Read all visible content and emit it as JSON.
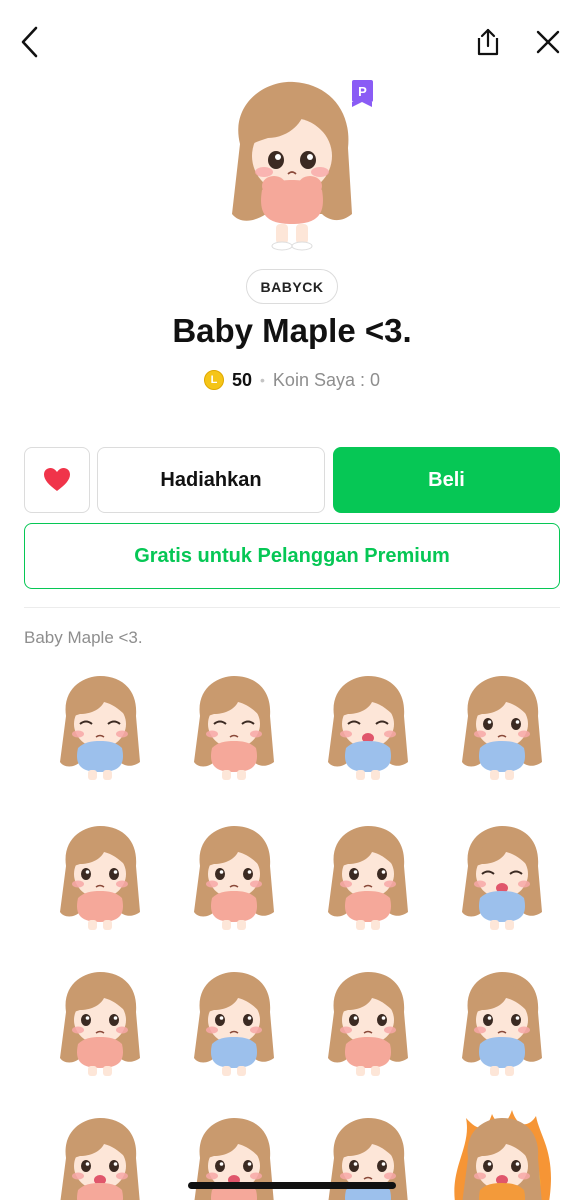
{
  "header": {
    "back_icon": "chevron-left-icon",
    "share_icon": "share-icon",
    "close_icon": "close-icon"
  },
  "product": {
    "premium_badge": "P",
    "author": "BABYCK",
    "title": "Baby Maple <3.",
    "coin_symbol": "L",
    "price": "50",
    "separator": "•",
    "my_coins": "Koin Saya : 0"
  },
  "actions": {
    "favorite_icon": "heart-icon",
    "gift_label": "Hadiahkan",
    "buy_label": "Beli",
    "premium_label": "Gratis untuk Pelanggan Premium"
  },
  "sticker_section": {
    "label": "Baby Maple <3.",
    "stickers": [
      {
        "outfit": "blue",
        "expression": "wink"
      },
      {
        "outfit": "pink",
        "expression": "happy-closed"
      },
      {
        "outfit": "blue",
        "expression": "laugh-wink"
      },
      {
        "outfit": "blue",
        "expression": "wave"
      },
      {
        "outfit": "pink",
        "expression": "sad"
      },
      {
        "outfit": "pink",
        "expression": "pout"
      },
      {
        "outfit": "pink",
        "expression": "shy"
      },
      {
        "outfit": "blue",
        "expression": "joy"
      },
      {
        "outfit": "pink",
        "expression": "arms-up"
      },
      {
        "outfit": "blue",
        "expression": "hug"
      },
      {
        "outfit": "pink",
        "expression": "worried"
      },
      {
        "outfit": "blue",
        "expression": "stretch"
      },
      {
        "outfit": "pink",
        "expression": "cry"
      },
      {
        "outfit": "pink",
        "expression": "shock"
      },
      {
        "outfit": "blue",
        "expression": "blush"
      },
      {
        "outfit": "orange",
        "expression": "angry-fire"
      }
    ]
  },
  "colors": {
    "accent_green": "#06c755",
    "premium_purple": "#8a5cf5",
    "heart_red": "#f0344a",
    "coin_gold": "#f5c518",
    "hair": "#c99a6e",
    "skin": "#fde6d8",
    "outfit_pink": "#f5a89a",
    "outfit_blue": "#9cc0ec"
  }
}
